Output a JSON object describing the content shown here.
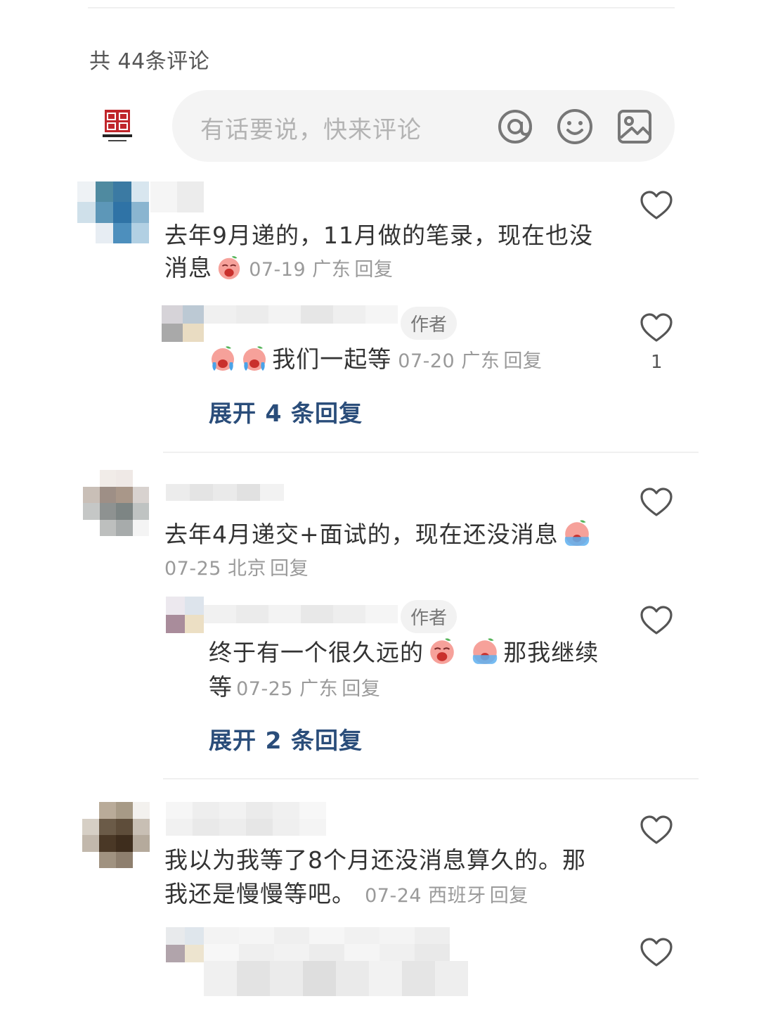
{
  "header": {
    "comment_count_label": "共 44条评论"
  },
  "input": {
    "placeholder": "有话要说，快来评论"
  },
  "colors": {
    "link": "#2a4d7a",
    "meta": "#9a9a9a",
    "text": "#333333",
    "input_bg": "#f4f4f4",
    "logo_red": "#c0262b"
  },
  "icons": {
    "mention": "at-sign-icon",
    "emoji": "smiley-icon",
    "image": "image-icon",
    "like": "heart-outline-icon",
    "crying_emoji": "crying-emoji-icon"
  },
  "comments": [
    {
      "text_line1": "去年9月递的，11月做的笔录，现在也没",
      "text_line2": "消息",
      "meta": "07-19 广东",
      "reply_label": "回复",
      "reply": {
        "author_tag": "作者",
        "text": "我们一起等",
        "meta": "07-20 广东",
        "reply_label": "回复",
        "likes": "1"
      },
      "expand_label": "展开 4 条回复"
    },
    {
      "text_line1": "去年4月递交+面试的，现在还没消息",
      "meta": "07-25 北京",
      "reply_label": "回复",
      "reply": {
        "author_tag": "作者",
        "text_part1": "终于有一个很久远的",
        "text_part2": "那我继续",
        "text_line2": "等",
        "meta": "07-25 广东",
        "reply_label": "回复"
      },
      "expand_label": "展开 2 条回复"
    },
    {
      "text_line1": "我以为我等了8个月还没消息算久的。那",
      "text_line2": "我还是慢慢等吧。",
      "meta": "07-24 西班牙",
      "reply_label": "回复"
    }
  ]
}
